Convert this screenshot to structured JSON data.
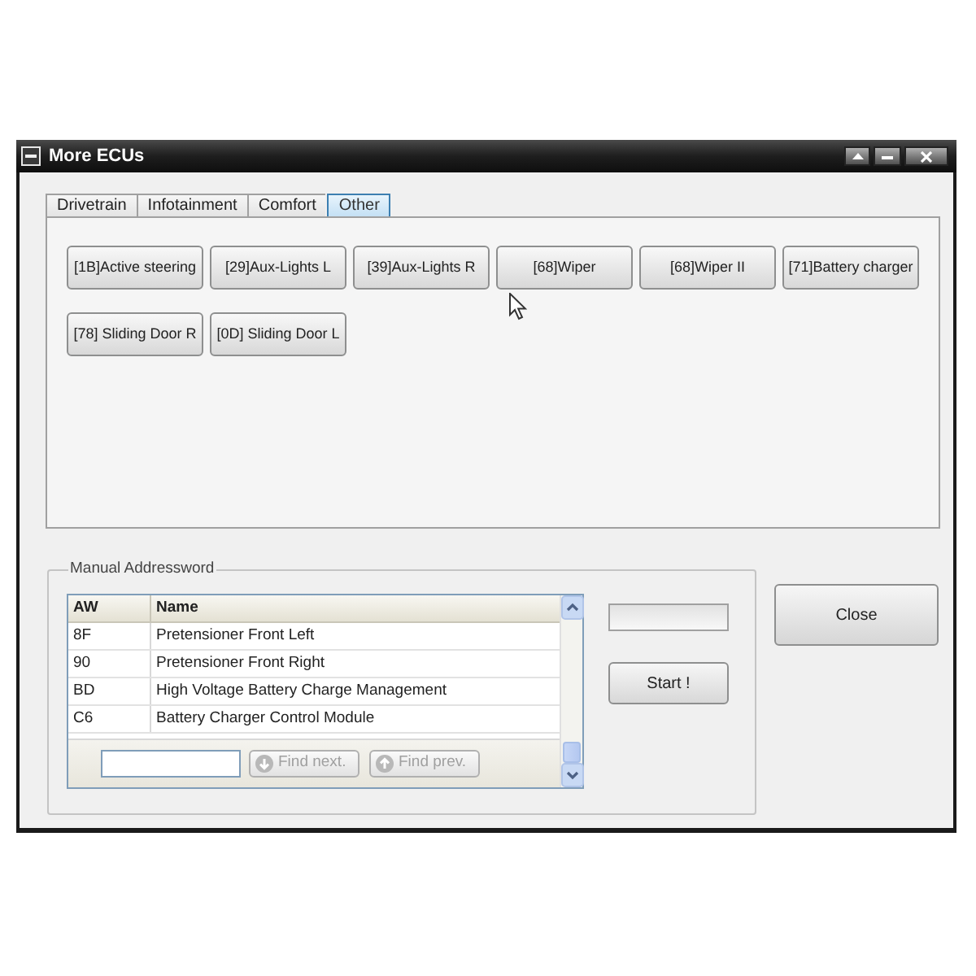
{
  "window": {
    "title": "More ECUs"
  },
  "tabs": [
    {
      "label": "Drivetrain",
      "selected": false
    },
    {
      "label": "Infotainment",
      "selected": false
    },
    {
      "label": "Comfort",
      "selected": false
    },
    {
      "label": "Other",
      "selected": true
    }
  ],
  "ecu_buttons": [
    {
      "label": "[1B]Active steering"
    },
    {
      "label": "[29]Aux-Lights L"
    },
    {
      "label": "[39]Aux-Lights R"
    },
    {
      "label": "[68]Wiper"
    },
    {
      "label": "[68]Wiper II"
    },
    {
      "label": "[71]Battery charger"
    },
    {
      "label": "[78] Sliding Door R"
    },
    {
      "label": "[0D] Sliding Door L"
    }
  ],
  "manual_addressword": {
    "title": "Manual Addressword",
    "table": {
      "columns": [
        "AW",
        "Name"
      ],
      "rows": [
        [
          "8F",
          "Pretensioner Front Left"
        ],
        [
          "90",
          "Pretensioner Front Right"
        ],
        [
          "BD",
          "High Voltage Battery Charge Management"
        ],
        [
          "C6",
          "Battery Charger Control Module"
        ]
      ]
    },
    "find_buttons": [
      {
        "kind": "next",
        "label": "Find next.",
        "disabled": true
      },
      {
        "kind": "prev",
        "label": "Find prev.",
        "disabled": true
      }
    ],
    "progress_bar": {
      "level": 0
    },
    "start_button": {
      "label": "Start !"
    }
  },
  "close_button": {
    "label": "Close"
  }
}
